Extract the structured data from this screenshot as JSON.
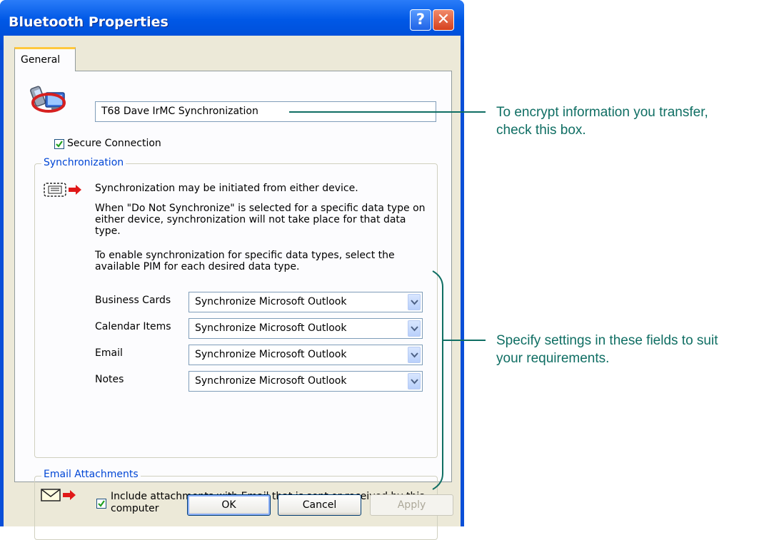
{
  "window": {
    "title": "Bluetooth Properties"
  },
  "tabs": [
    {
      "label": "General",
      "selected": true
    }
  ],
  "service_name": "T68 Dave IrMC Synchronization",
  "secure_connection": {
    "label": "Secure Connection",
    "checked": true
  },
  "synchronization": {
    "title": "Synchronization",
    "paragraph1": "Synchronization may be initiated from either device.",
    "paragraph2": "When \"Do Not Synchronize\" is selected for a specific data type on either device, synchronization will not take place for that data type.",
    "paragraph3": "To enable synchronization for specific data types, select the available PIM for each desired data type.",
    "rows": [
      {
        "label": "Business Cards",
        "value": "Synchronize Microsoft Outlook"
      },
      {
        "label": "Calendar Items",
        "value": "Synchronize Microsoft Outlook"
      },
      {
        "label": "Email",
        "value": "Synchronize Microsoft Outlook"
      },
      {
        "label": "Notes",
        "value": "Synchronize Microsoft Outlook"
      }
    ]
  },
  "email_attachments": {
    "title": "Email Attachments",
    "label": "Include attachments with Email that is sent or received by this computer",
    "checked": true
  },
  "buttons": {
    "ok": "OK",
    "cancel": "Cancel",
    "apply": "Apply"
  },
  "callouts": {
    "top_line1": "To encrypt information you transfer,",
    "top_line2": "check this box.",
    "bottom_line1": "Specify settings in these fields to suit",
    "bottom_line2": "your requirements."
  },
  "colors": {
    "titlebar": "#0058e6",
    "callout": "#0f6e63",
    "group_title": "#0046d5"
  }
}
